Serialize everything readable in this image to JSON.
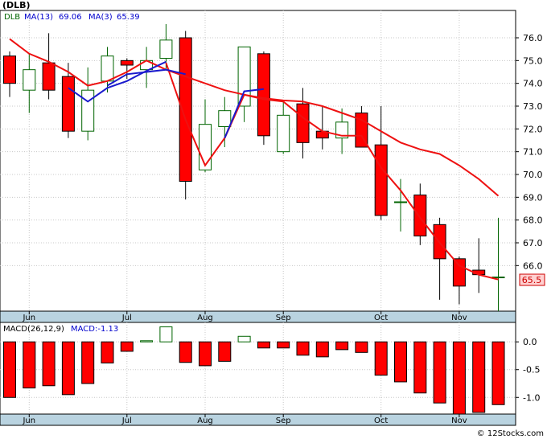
{
  "title": "(DLB)",
  "watermark": "© 12Stocks.com",
  "chart_data": [
    {
      "type": "candlestick",
      "ticker": "DLB",
      "legend": [
        {
          "label": "DLB",
          "color": "#006400"
        },
        {
          "label": "MA(13)",
          "value": "69.06",
          "color": "#0000cd"
        },
        {
          "label": "MA(3)",
          "value": "65.39",
          "color": "#0000cd"
        }
      ],
      "last_price_label": "65.5",
      "x_labels": [
        {
          "label": "Jun",
          "idx": 1
        },
        {
          "label": "Jul",
          "idx": 6
        },
        {
          "label": "Aug",
          "idx": 10
        },
        {
          "label": "Sep",
          "idx": 14
        },
        {
          "label": "Oct",
          "idx": 19
        },
        {
          "label": "Nov",
          "idx": 23
        }
      ],
      "y_ticks": [
        "66.0",
        "67.0",
        "68.0",
        "69.0",
        "70.0",
        "71.0",
        "72.0",
        "73.0",
        "74.0",
        "75.0",
        "76.0"
      ],
      "ylim": [
        64.0,
        77.2
      ],
      "candles": [
        {
          "o": 75.2,
          "h": 75.4,
          "l": 73.4,
          "c": 74.0
        },
        {
          "o": 73.7,
          "h": 75.3,
          "l": 72.7,
          "c": 74.6
        },
        {
          "o": 74.9,
          "h": 76.2,
          "l": 73.3,
          "c": 73.7
        },
        {
          "o": 74.3,
          "h": 74.9,
          "l": 71.6,
          "c": 71.9
        },
        {
          "o": 71.9,
          "h": 74.7,
          "l": 71.5,
          "c": 73.7
        },
        {
          "o": 74.1,
          "h": 75.6,
          "l": 73.6,
          "c": 75.2
        },
        {
          "o": 75.0,
          "h": 75.1,
          "l": 74.2,
          "c": 74.8
        },
        {
          "o": 74.6,
          "h": 75.6,
          "l": 73.8,
          "c": 75.0
        },
        {
          "o": 75.1,
          "h": 76.6,
          "l": 74.6,
          "c": 75.9
        },
        {
          "o": 76.0,
          "h": 76.3,
          "l": 68.9,
          "c": 69.7
        },
        {
          "o": 70.2,
          "h": 73.3,
          "l": 70.1,
          "c": 72.2
        },
        {
          "o": 72.1,
          "h": 73.4,
          "l": 71.2,
          "c": 72.8
        },
        {
          "o": 73.0,
          "h": 75.6,
          "l": 72.3,
          "c": 75.6
        },
        {
          "o": 75.3,
          "h": 75.4,
          "l": 71.3,
          "c": 71.7
        },
        {
          "o": 71.0,
          "h": 73.2,
          "l": 70.9,
          "c": 72.6
        },
        {
          "o": 73.1,
          "h": 73.8,
          "l": 70.7,
          "c": 71.4
        },
        {
          "o": 71.9,
          "h": 73.0,
          "l": 71.1,
          "c": 71.6
        },
        {
          "o": 71.6,
          "h": 72.9,
          "l": 70.9,
          "c": 72.3
        },
        {
          "o": 72.7,
          "h": 73.0,
          "l": 71.2,
          "c": 71.2
        },
        {
          "o": 71.3,
          "h": 73.0,
          "l": 68.0,
          "c": 68.2
        },
        {
          "o": 68.8,
          "h": 69.8,
          "l": 67.5,
          "c": 68.8
        },
        {
          "o": 69.1,
          "h": 69.6,
          "l": 66.9,
          "c": 67.3
        },
        {
          "o": 67.8,
          "h": 68.1,
          "l": 64.5,
          "c": 66.3
        },
        {
          "o": 66.3,
          "h": 66.4,
          "l": 64.3,
          "c": 65.1
        },
        {
          "o": 65.8,
          "h": 67.2,
          "l": 64.8,
          "c": 65.6
        },
        {
          "o": 65.5,
          "h": 68.1,
          "l": 64.0,
          "c": 65.5
        }
      ],
      "ma13": [
        {
          "i": 0,
          "v": 75.95
        },
        {
          "i": 1,
          "v": 75.3
        },
        {
          "i": 2,
          "v": 74.95
        },
        {
          "i": 3,
          "v": 74.5
        },
        {
          "i": 4,
          "v": 73.9
        },
        {
          "i": 5,
          "v": 74.1
        },
        {
          "i": 6,
          "v": 74.5
        },
        {
          "i": 7,
          "v": 75.0
        },
        {
          "i": 8,
          "v": 74.6
        },
        {
          "i": 9,
          "v": 74.3
        },
        {
          "i": 10,
          "v": 74.0
        },
        {
          "i": 11,
          "v": 73.7
        },
        {
          "i": 12,
          "v": 73.5
        },
        {
          "i": 13,
          "v": 73.35
        },
        {
          "i": 14,
          "v": 73.25
        },
        {
          "i": 15,
          "v": 73.2
        },
        {
          "i": 16,
          "v": 73.0
        },
        {
          "i": 17,
          "v": 72.7
        },
        {
          "i": 18,
          "v": 72.4
        },
        {
          "i": 19,
          "v": 71.9
        },
        {
          "i": 20,
          "v": 71.4
        },
        {
          "i": 21,
          "v": 71.1
        },
        {
          "i": 22,
          "v": 70.9
        },
        {
          "i": 23,
          "v": 70.4
        },
        {
          "i": 24,
          "v": 69.8
        },
        {
          "i": 25,
          "v": 69.06
        }
      ],
      "ma3_blue": [
        {
          "i": 3,
          "v": 73.8
        },
        {
          "i": 4,
          "v": 73.2
        },
        {
          "i": 5,
          "v": 73.8
        },
        {
          "i": 6,
          "v": 74.1
        },
        {
          "i": 7,
          "v": 74.55
        },
        {
          "i": 8,
          "v": 74.95
        }
      ],
      "ma3_blue_b": [
        {
          "i": 5,
          "v": 73.9
        },
        {
          "i": 6,
          "v": 74.4
        },
        {
          "i": 7,
          "v": 74.5
        },
        {
          "i": 8,
          "v": 74.6
        },
        {
          "i": 9,
          "v": 74.4
        }
      ],
      "ma3_blue_c": [
        {
          "i": 11,
          "v": 71.6
        },
        {
          "i": 12,
          "v": 73.65
        },
        {
          "i": 13,
          "v": 73.75
        }
      ],
      "ma3_red": [
        {
          "i": 8,
          "v": 74.9
        },
        {
          "i": 9,
          "v": 72.4
        },
        {
          "i": 10,
          "v": 70.4
        },
        {
          "i": 11,
          "v": 71.6
        },
        {
          "i": 12,
          "v": 73.5
        },
        {
          "i": 13,
          "v": 73.3
        },
        {
          "i": 14,
          "v": 73.2
        },
        {
          "i": 15,
          "v": 72.5
        },
        {
          "i": 16,
          "v": 71.9
        },
        {
          "i": 17,
          "v": 71.7
        },
        {
          "i": 18,
          "v": 71.7
        },
        {
          "i": 19,
          "v": 70.3
        },
        {
          "i": 20,
          "v": 69.3
        },
        {
          "i": 21,
          "v": 68.1
        },
        {
          "i": 22,
          "v": 67.0
        },
        {
          "i": 23,
          "v": 66.0
        },
        {
          "i": 24,
          "v": 65.6
        },
        {
          "i": 25,
          "v": 65.39
        }
      ]
    },
    {
      "type": "bar",
      "legend": [
        {
          "label": "MACD(26,12,9)",
          "color": "#000000"
        },
        {
          "label": "MACD:-1.13",
          "color": "#0000cd"
        }
      ],
      "y_ticks": [
        "0.0",
        "-0.5",
        "-1.0"
      ],
      "ylim": [
        -1.3,
        0.35
      ],
      "x_labels": [
        {
          "label": "Jun",
          "idx": 1
        },
        {
          "label": "Jul",
          "idx": 6
        },
        {
          "label": "Aug",
          "idx": 10
        },
        {
          "label": "Sep",
          "idx": 14
        },
        {
          "label": "Oct",
          "idx": 19
        },
        {
          "label": "Nov",
          "idx": 23
        }
      ],
      "values": [
        -1.0,
        -0.83,
        -0.79,
        -0.95,
        -0.75,
        -0.38,
        -0.17,
        0.02,
        0.27,
        -0.37,
        -0.43,
        -0.35,
        0.1,
        -0.11,
        -0.11,
        -0.24,
        -0.27,
        -0.14,
        -0.19,
        -0.6,
        -0.72,
        -0.92,
        -1.1,
        -1.3,
        -1.27,
        -1.13
      ]
    }
  ]
}
